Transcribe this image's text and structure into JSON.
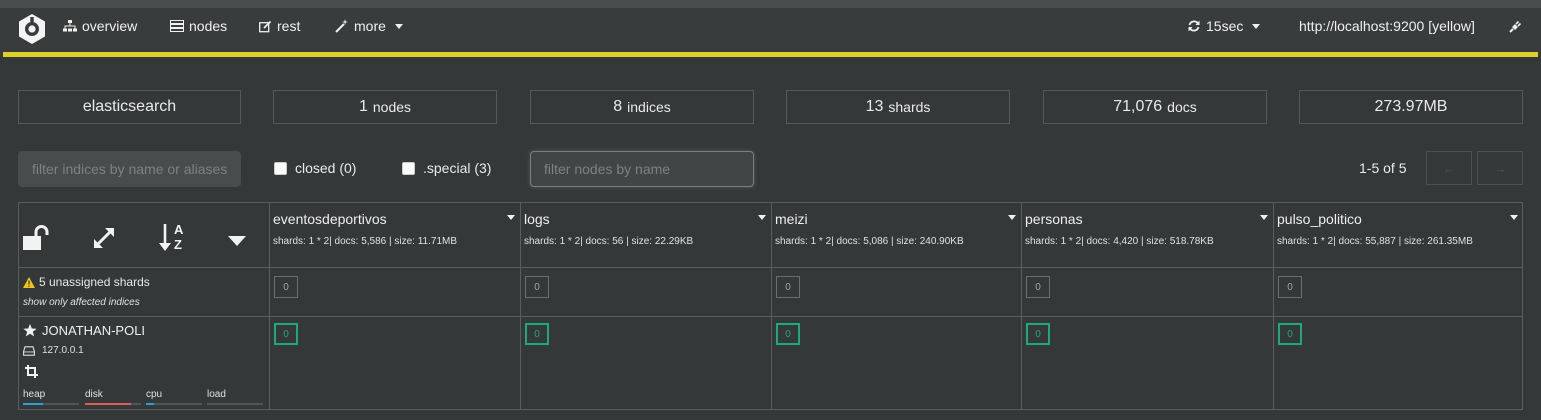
{
  "nav": {
    "overview": "overview",
    "nodes": "nodes",
    "rest": "rest",
    "more": "more",
    "refresh": "15sec",
    "host": "http://localhost:9200 [yellow]"
  },
  "stats": {
    "cluster": "elasticsearch",
    "nodes_count": "1",
    "nodes_label": "nodes",
    "indices_count": "8",
    "indices_label": "indices",
    "shards_count": "13",
    "shards_label": "shards",
    "docs_count": "71,076",
    "docs_label": "docs",
    "size": "273.97MB"
  },
  "filters": {
    "indices_placeholder": "filter indices by name or aliases",
    "closed_label": "closed (0)",
    "special_label": ".special (3)",
    "nodes_placeholder": "filter nodes by name",
    "pagination": "1-5 of 5",
    "prev": "←",
    "next": "→"
  },
  "indices": [
    {
      "name": "eventosdeportivos",
      "meta": "shards: 1 * 2| docs: 5,586 | size: 11.71MB",
      "unassigned": "0",
      "shard": "0"
    },
    {
      "name": "logs",
      "meta": "shards: 1 * 2| docs: 56 | size: 22.29KB",
      "unassigned": "0",
      "shard": "0"
    },
    {
      "name": "meizi",
      "meta": "shards: 1 * 2| docs: 5,086 | size: 240.90KB",
      "unassigned": "0",
      "shard": "0"
    },
    {
      "name": "personas",
      "meta": "shards: 1 * 2| docs: 4,420 | size: 518.78KB",
      "unassigned": "0",
      "shard": "0"
    },
    {
      "name": "pulso_politico",
      "meta": "shards: 1 * 2| docs: 55,887 | size: 261.35MB",
      "unassigned": "0",
      "shard": "0"
    }
  ],
  "unassigned": {
    "text": "5 unassigned shards",
    "link": "show only affected indices"
  },
  "node": {
    "name": "JONATHAN-POLI",
    "ip": "127.0.0.1",
    "metrics": [
      {
        "label": "heap",
        "fraction": 0.35,
        "color": "#2a9fd6"
      },
      {
        "label": "disk",
        "fraction": 0.82,
        "color": "#e05a5a"
      },
      {
        "label": "cpu",
        "fraction": 0.15,
        "color": "#2a9fd6"
      },
      {
        "label": "load",
        "fraction": 0.0,
        "color": "#2a9fd6"
      }
    ]
  },
  "colors": {
    "accent": "#e0d12a",
    "shard_ok": "#1ea97c",
    "warning": "#f0c419"
  }
}
